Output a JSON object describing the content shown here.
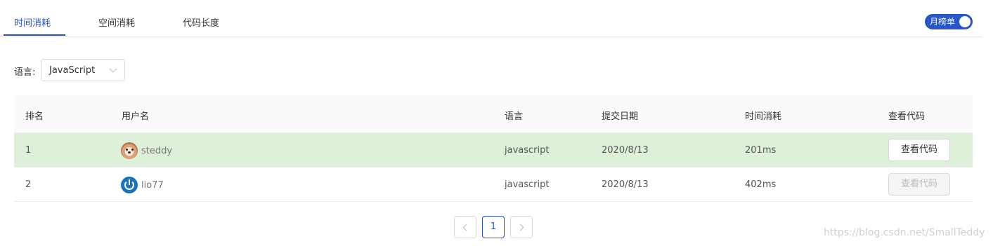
{
  "tabs": [
    {
      "label": "时间消耗",
      "active": true
    },
    {
      "label": "空间消耗",
      "active": false
    },
    {
      "label": "代码长度",
      "active": false
    }
  ],
  "toggle": {
    "label": "月榜单",
    "on": true
  },
  "filter": {
    "label": "语言:",
    "value": "JavaScript"
  },
  "table": {
    "headers": [
      "排名",
      "用户名",
      "语言",
      "提交日期",
      "时间消耗",
      "查看代码"
    ],
    "rows": [
      {
        "rank": "1",
        "username": "steddy",
        "avatar": "dog-avatar",
        "language": "javascript",
        "date": "2020/8/13",
        "time": "201ms",
        "action": "查看代码",
        "action_enabled": true,
        "highlighted": true
      },
      {
        "rank": "2",
        "username": "lio77",
        "avatar": "power-avatar",
        "language": "javascript",
        "date": "2020/8/13",
        "time": "402ms",
        "action": "查看代码",
        "action_enabled": false,
        "highlighted": false
      }
    ]
  },
  "pagination": {
    "current_page": "1"
  },
  "watermark": "https://blog.csdn.net/SmallTeddy",
  "colors": {
    "accent": "#2855c8",
    "highlight_row": "#deefda"
  }
}
